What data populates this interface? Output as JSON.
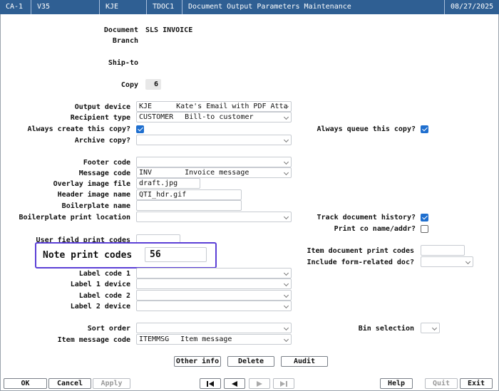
{
  "titlebar": {
    "company": "CA-1",
    "version": "V35",
    "user": "KJE",
    "program": "TDOC1",
    "title": "Document Output Parameters Maintenance",
    "date": "08/27/2025"
  },
  "header": {
    "document_label": "Document",
    "document_value": "SLS INVOICE",
    "branch_label": "Branch",
    "shipto_label": "Ship-to",
    "copy_label": "Copy",
    "copy_value": "6"
  },
  "form": {
    "output_device_label": "Output device",
    "output_device_code": "KJE",
    "output_device_desc": "Kate's Email with PDF Atta",
    "recipient_type_label": "Recipient type",
    "recipient_type_code": "CUSTOMER",
    "recipient_type_desc": "Bill-to customer",
    "always_create_label": "Always create this copy?",
    "always_create_checked": true,
    "always_queue_label": "Always queue this copy?",
    "always_queue_checked": true,
    "archive_copy_label": "Archive copy?",
    "archive_copy_value": "",
    "footer_code_label": "Footer code",
    "footer_code_value": "",
    "message_code_label": "Message code",
    "message_code_code": "INV",
    "message_code_desc": "Invoice message",
    "overlay_image_label": "Overlay image file",
    "overlay_image_value": "draft.jpg",
    "header_image_label": "Header image name",
    "header_image_value": "QTI_hdr.gif",
    "boilerplate_name_label": "Boilerplate name",
    "boilerplate_name_value": "",
    "boilerplate_loc_label": "Boilerplate print location",
    "boilerplate_loc_value": "",
    "track_history_label": "Track document history?",
    "track_history_checked": true,
    "print_co_label": "Print co name/addr?",
    "print_co_checked": false,
    "user_field_label": "User field print codes",
    "user_field_value": "",
    "note_print_label": "Note print codes",
    "note_print_value": "56",
    "item_doc_print_label": "Item document print codes",
    "item_doc_print_value": "",
    "include_form_label": "Include form-related doc?",
    "include_form_value": "",
    "label_code1_label": "Label code 1",
    "label1_device_label": "Label 1 device",
    "label_code2_label": "Label code 2",
    "label2_device_label": "Label 2 device",
    "sort_order_label": "Sort order",
    "bin_selection_label": "Bin selection",
    "item_message_label": "Item message code",
    "item_message_code": "ITEMMSG",
    "item_message_desc": "Item message"
  },
  "actions": {
    "other_info": "Other info",
    "delete": "Delete",
    "audit": "Audit"
  },
  "footer": {
    "ok": "OK",
    "cancel": "Cancel",
    "apply": "Apply",
    "help": "Help",
    "quit": "Quit",
    "exit": "Exit"
  }
}
